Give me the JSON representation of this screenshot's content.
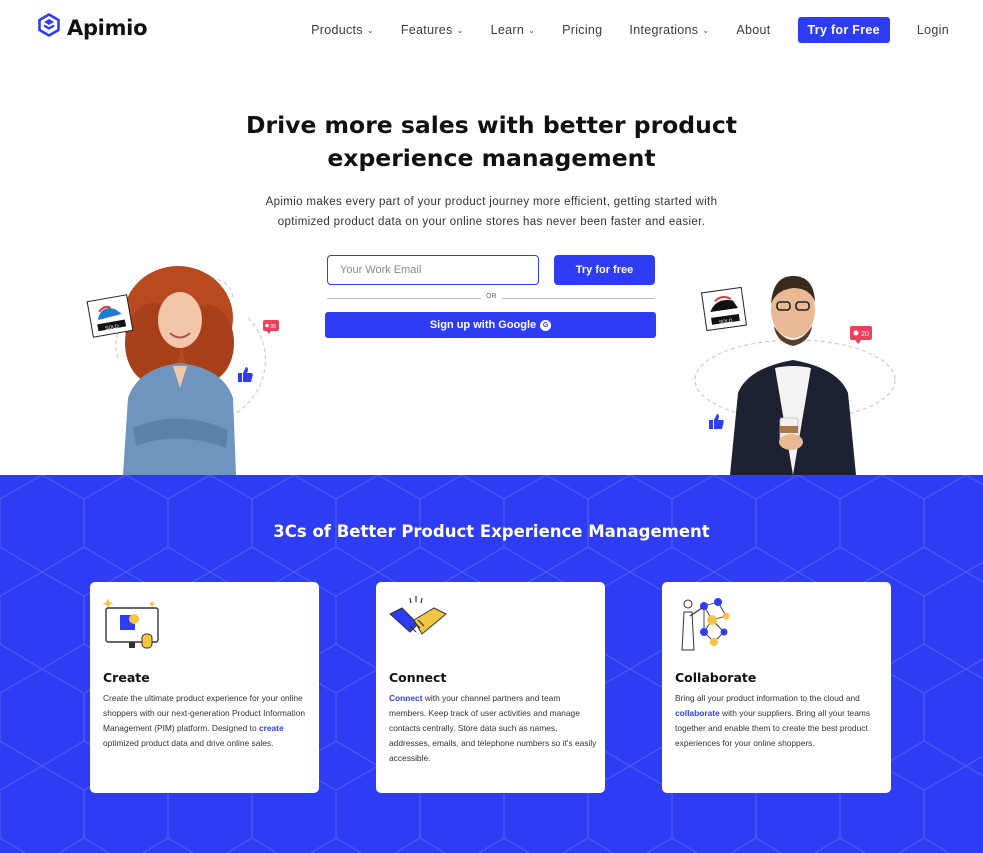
{
  "brand": {
    "name": "Apimio",
    "logo_icon": "apimio-cube-icon",
    "color": "#2e3cf4"
  },
  "nav": {
    "items": [
      {
        "label": "Products",
        "dropdown": true
      },
      {
        "label": "Features",
        "dropdown": true
      },
      {
        "label": "Learn",
        "dropdown": true
      },
      {
        "label": "Pricing",
        "dropdown": false
      },
      {
        "label": "Integrations",
        "dropdown": true
      },
      {
        "label": "About",
        "dropdown": false
      }
    ],
    "cta_label": "Try for Free",
    "login_label": "Login"
  },
  "hero": {
    "title_line1": "Drive more sales with better product",
    "title_line2": "experience management",
    "subtitle_line1": "Apimio makes every part of your product journey more efficient, getting started with",
    "subtitle_line2": "optimized product data on your online stores has never been faster and easier.",
    "email_placeholder": "Your Work Email",
    "try_button": "Try for free",
    "or_text": "OR",
    "google_button": "Sign up with Google",
    "google_icon": "google-plus-icon"
  },
  "illustrations": {
    "left_tag": "SOLD",
    "left_badge": "35",
    "right_tag": "SOLD",
    "right_badge": "20"
  },
  "section": {
    "title": "3Cs of Better Product Experience Management",
    "cards": [
      {
        "title": "Create",
        "icon": "monitor-design-icon",
        "text_before": "Create the ultimate product experience for your online shoppers with our next-generation Product Information Management (PIM) platform. Designed to ",
        "link": "create",
        "text_after": " optimized product data and drive online sales."
      },
      {
        "title": "Connect",
        "icon": "handshake-icon",
        "text_before": "",
        "link": "Connect",
        "text_after": " with your channel partners and team members. Keep track of user activities and manage contacts centrally. Store data such as names, addresses, emails, and telephone numbers so it's easily accessible."
      },
      {
        "title": "Collaborate",
        "icon": "network-person-icon",
        "text_before": "Bring all your product information to the cloud and ",
        "link": "collaborate",
        "text_after": " with your suppliers. Bring all your teams together and enable them to create the best product experiences for your online shoppers."
      }
    ]
  }
}
